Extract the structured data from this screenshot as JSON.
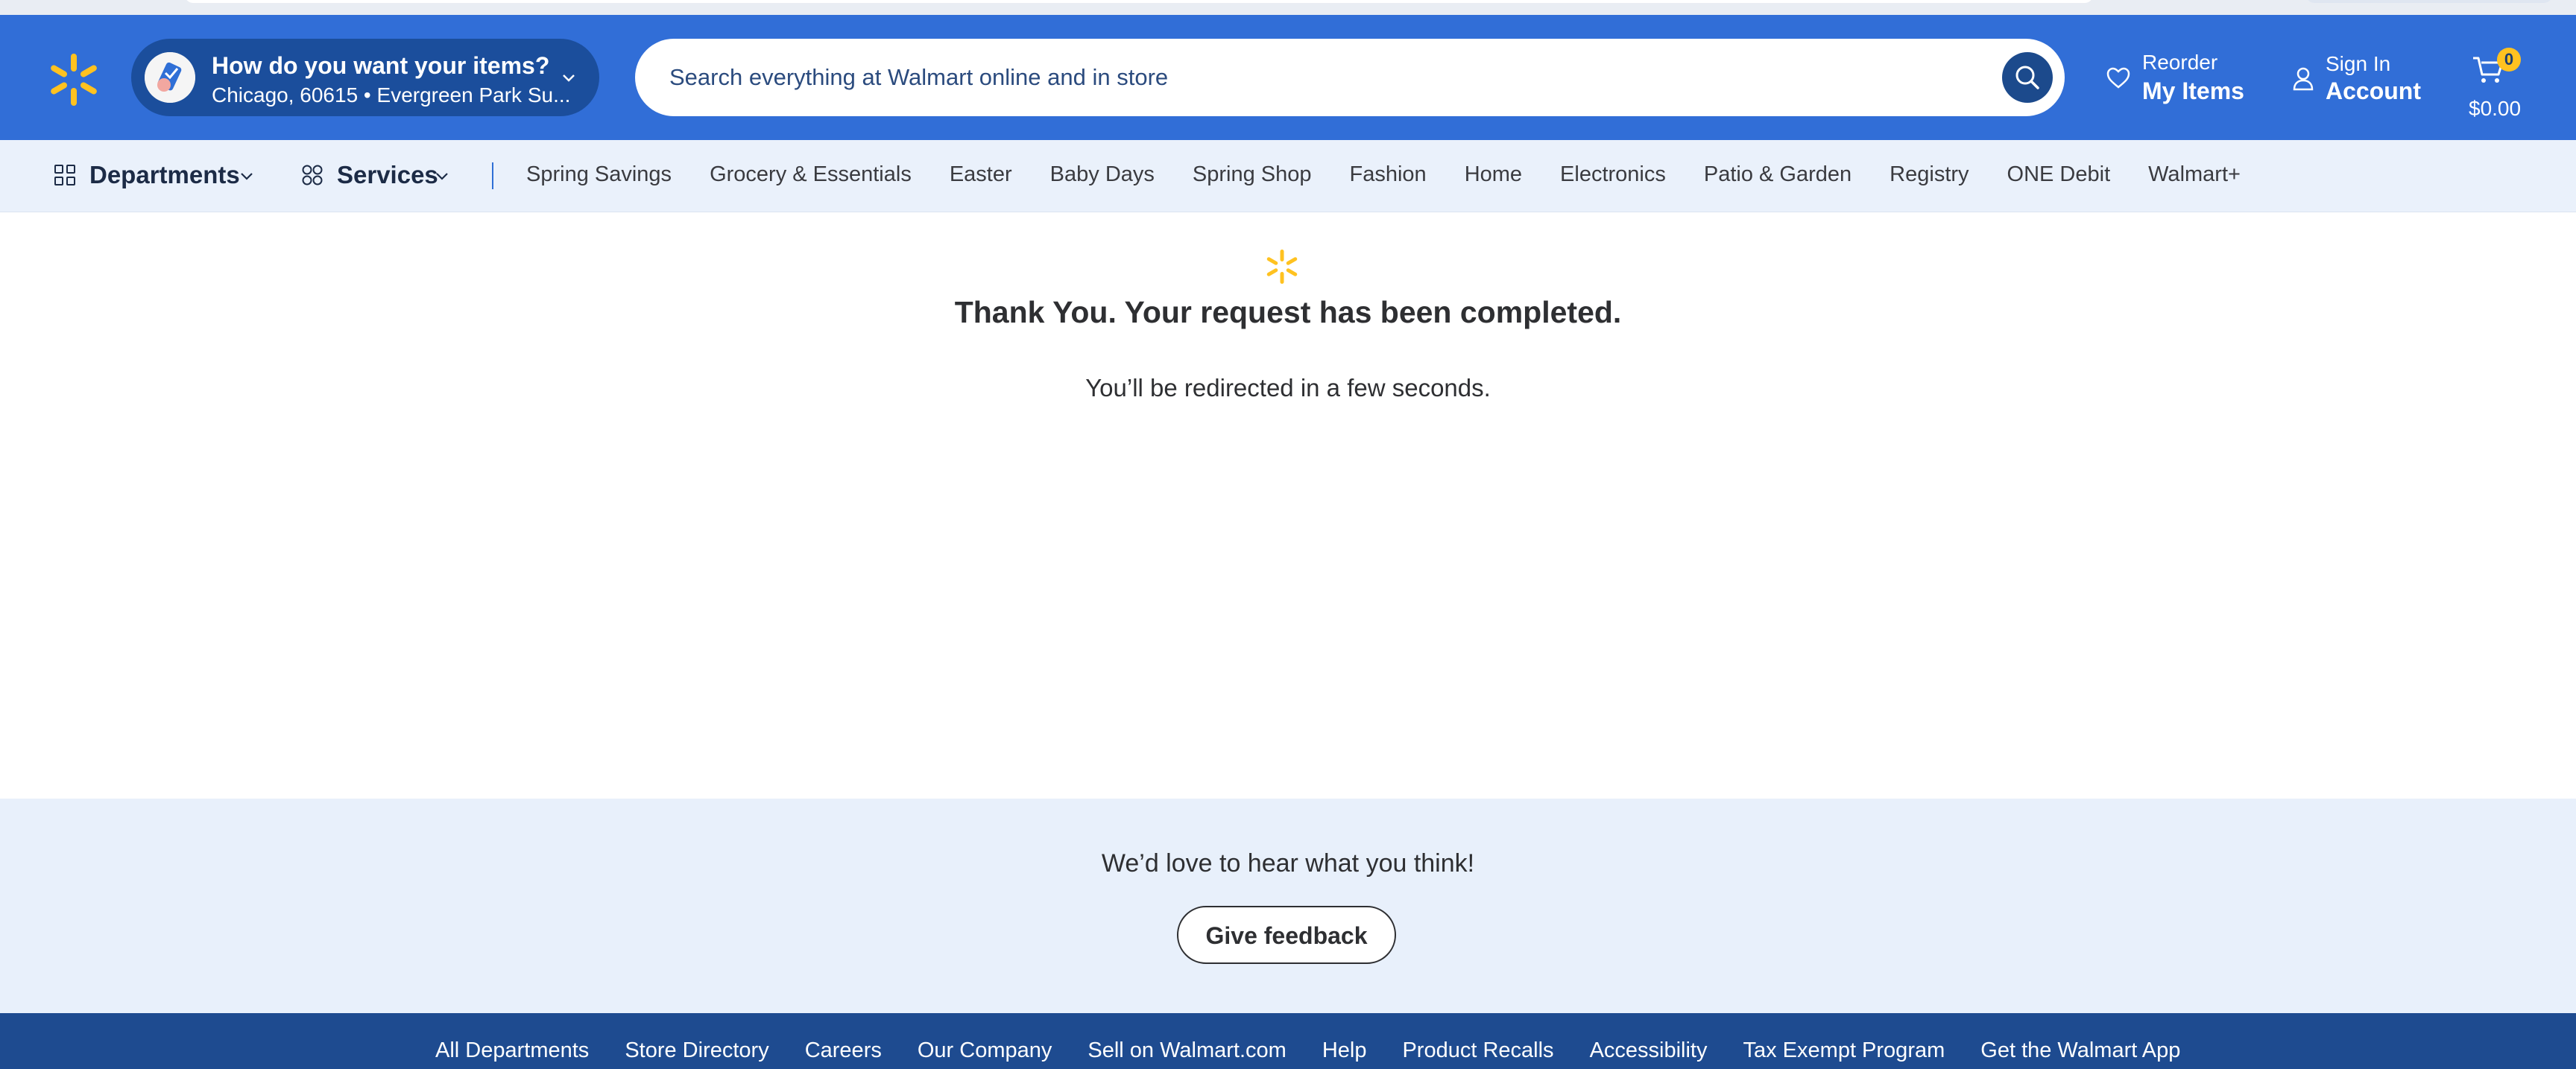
{
  "colors": {
    "header_bg": "#316ed7",
    "spark_yellow": "#ffc220",
    "nav_bg": "#eaf1fb",
    "feedback_bg": "#e8f0fb",
    "footer_bg": "#1e4b90"
  },
  "header": {
    "logo_icon": "walmart-spark-icon",
    "delivery": {
      "title": "How do you want your items?",
      "subtitle": "Chicago, 60615 • Evergreen Park Su..."
    },
    "search": {
      "placeholder": "Search everything at Walmart online and in store",
      "icon": "search-icon"
    },
    "reorder": {
      "line1": "Reorder",
      "line2": "My Items",
      "icon": "heart-icon"
    },
    "account": {
      "line1": "Sign In",
      "line2": "Account",
      "icon": "user-icon"
    },
    "cart": {
      "count": "0",
      "total": "$0.00",
      "icon": "cart-icon"
    }
  },
  "nav": {
    "departments": "Departments",
    "services": "Services",
    "links": [
      "Spring Savings",
      "Grocery & Essentials",
      "Easter",
      "Baby Days",
      "Spring Shop",
      "Fashion",
      "Home",
      "Electronics",
      "Patio & Garden",
      "Registry",
      "ONE Debit",
      "Walmart+"
    ]
  },
  "main": {
    "heading": "Thank You. Your request has been completed.",
    "message": "You’ll be redirected in a few seconds."
  },
  "feedback": {
    "prompt": "We’d love to hear what you think!",
    "button": "Give feedback"
  },
  "footer": {
    "links": [
      "All Departments",
      "Store Directory",
      "Careers",
      "Our Company",
      "Sell on Walmart.com",
      "Help",
      "Product Recalls",
      "Accessibility",
      "Tax Exempt Program",
      "Get the Walmart App"
    ]
  }
}
